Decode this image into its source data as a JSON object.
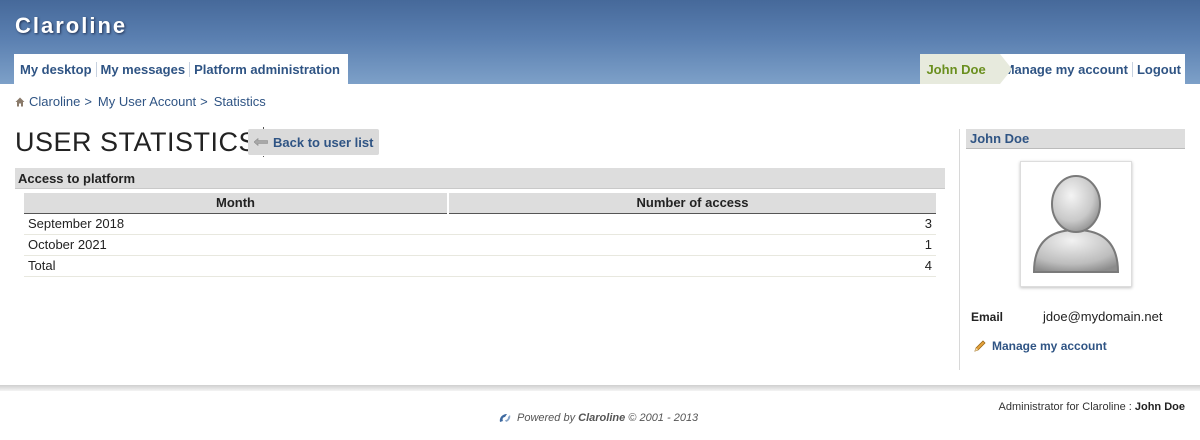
{
  "app": {
    "logo": "Claroline"
  },
  "nav": {
    "left": [
      "My desktop",
      "My messages",
      "Platform administration"
    ],
    "user": "John Doe",
    "right": [
      "Manage my account",
      "Logout"
    ]
  },
  "breadcrumb": {
    "items": [
      "Claroline",
      "My User Account",
      "Statistics"
    ],
    "separator": ">"
  },
  "page": {
    "title": "USER STATISTICS",
    "back_label": "Back to user list"
  },
  "section": {
    "title": "Access to platform"
  },
  "table": {
    "headers": [
      "Month",
      "Number of access"
    ],
    "rows": [
      {
        "month": "September 2018",
        "count": "3"
      },
      {
        "month": "October 2021",
        "count": "1"
      },
      {
        "month": "Total",
        "count": "4"
      }
    ]
  },
  "sidebar": {
    "user_name": "John Doe",
    "email_label": "Email",
    "email": "jdoe@mydomain.net",
    "manage_label": "Manage my account",
    "avatar_icon": "default-user-avatar-icon"
  },
  "footer": {
    "admin_prefix": "Administrator for Claroline :",
    "admin_name": "John Doe",
    "powered_prefix": "Powered by",
    "powered_brand": "Claroline",
    "powered_suffix": "© 2001 - 2013"
  },
  "colors": {
    "header_top": "#46699a",
    "header_bottom": "#7da0c8",
    "link": "#2f5484",
    "user_green": "#6a8f1e"
  }
}
